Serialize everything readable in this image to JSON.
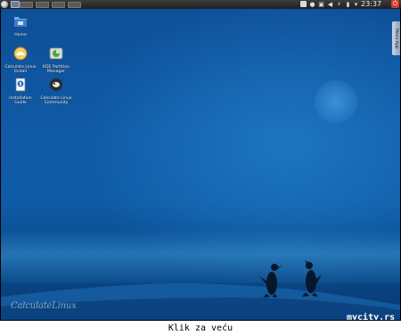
{
  "taskbar": {
    "clock": "23:37",
    "tray_icons": [
      "document-icon",
      "network-icon",
      "volume-icon",
      "usb-icon",
      "battery-icon",
      "notification-icon"
    ],
    "pager_count": 4
  },
  "desktop_icons": [
    {
      "name": "home",
      "label": "Home",
      "icon": "folder-icon"
    },
    {
      "name": "calculate-linux-install",
      "label": "Calculate Linux\nInstall",
      "icon": "installer-icon"
    },
    {
      "name": "kde-partition-manager",
      "label": "KDE Partition\nManager",
      "icon": "partition-icon"
    },
    {
      "name": "installation-guide",
      "label": "Installation\nGuide",
      "icon": "guide-icon"
    },
    {
      "name": "calculate-linux-community",
      "label": "Calculate Linux\nCommunity",
      "icon": "community-icon"
    }
  ],
  "widget_tab": {
    "label": "Menu App"
  },
  "wallpaper": {
    "logo_text": "CalculateLinux",
    "watermark": "mycity.rs"
  },
  "caption": "Klik za veću",
  "colors": {
    "desktop_top": "#0e4f98",
    "desktop_bottom": "#083a73",
    "taskbar": "#2a2a2a",
    "power_red": "#d13a2a"
  }
}
